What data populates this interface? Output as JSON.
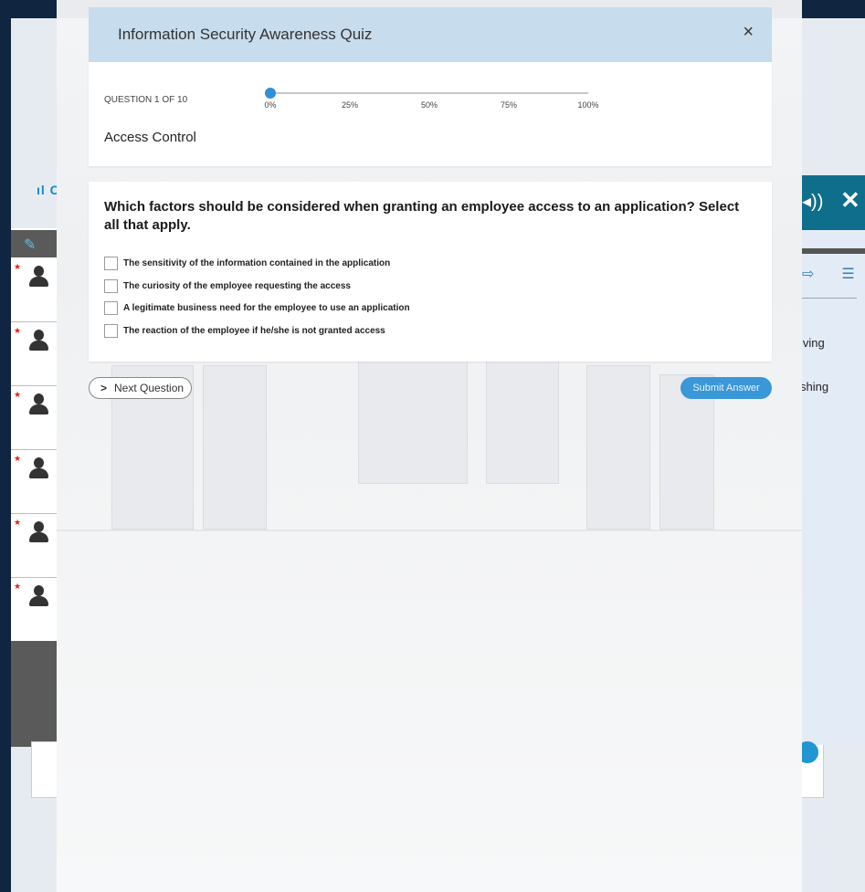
{
  "background": {
    "logo": "ıl C",
    "right_texts": [
      "iving",
      "shing"
    ]
  },
  "quiz": {
    "title": "Information Security Awareness Quiz",
    "close_glyph": "×",
    "progress": {
      "counter": "QUESTION 1 OF 10",
      "value_percent": 0,
      "ticks": [
        "0%",
        "25%",
        "50%",
        "75%",
        "100%"
      ]
    },
    "category": "Access Control",
    "question": "Which factors should be considered when granting an employee access to an application? Select all that apply.",
    "options": [
      "The sensitivity of the information contained in the application",
      "The curiosity of the employee requesting the access",
      "A legitimate business need for the employee to use an application",
      "The reaction of the employee if he/she is not granted access"
    ],
    "next_label": "Next Question",
    "submit_label": "Submit Answer"
  },
  "colors": {
    "header": "#c7dcec",
    "accent": "#2f8fd8",
    "background": "#10253f"
  }
}
